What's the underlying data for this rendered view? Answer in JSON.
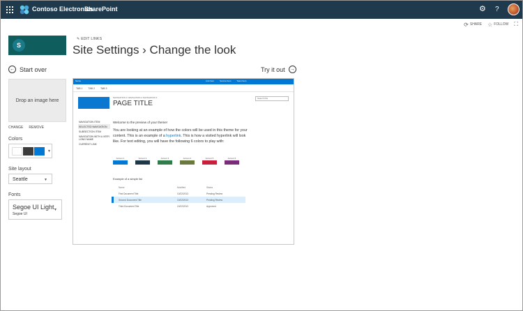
{
  "suite_bar": {
    "brand": "Contoso Electronics",
    "app": "SharePoint",
    "icons": [
      "app-launcher-icon",
      "contoso-logo",
      "gear-icon",
      "help-icon",
      "avatar"
    ]
  },
  "action_bar": {
    "share": "SHARE",
    "follow": "FOLLOW",
    "focus_icon": "focus-icon"
  },
  "header": {
    "logo_letter": "S",
    "edit_links": "EDIT LINKS",
    "title": "Site Settings › Change the look"
  },
  "nav": {
    "start_over": "Start over",
    "try_it_out": "Try it out"
  },
  "left_panel": {
    "drop_image": "Drop an image here",
    "change": "CHANGE",
    "remove": "REMOVE",
    "colors_label": "Colors",
    "color_swatches": [
      "#ffffff",
      "#3b3b3b",
      "#0078d4"
    ],
    "site_layout_label": "Site layout",
    "site_layout_value": "Seattle",
    "fonts_label": "Fonts",
    "font_heading": "Segoe UI Light",
    "font_body": "Segoe UI"
  },
  "preview": {
    "top_bar_name": "Name",
    "top_bar_links": [
      "Link Item",
      "Secure Item",
      "Team Item"
    ],
    "tabs": [
      "TAB 1",
      "TAB 2",
      "TAB 3"
    ],
    "breadcrumb": "NAVIGATION 1  NAVIGATION 2  NAVIGATION 3",
    "page_title": "PAGE TITLE",
    "search_placeholder": "Search this",
    "nav_items": [
      "NAVIGATION ITEM",
      "SELECTED NAVIGATION",
      "SUBSECTION ITEM",
      "NAVIGATION WITH A VERY LONG NAME",
      "CURRENT LINK"
    ],
    "welcome": "Welcome to the preview of your theme!",
    "text_before_link": "You are looking at an example of how the colors will be used in this theme for your content. This is an example of a ",
    "hyperlink": "hyperlink",
    "text_after_link": ". This is how a visited hyperlink will look like. For text editing, you will have the following 6 colors to play with:",
    "accents": [
      {
        "label": "Accent 1",
        "color": "#0078d4"
      },
      {
        "label": "Accent 2",
        "color": "#1e3848"
      },
      {
        "label": "Accent 3",
        "color": "#2e7d4a"
      },
      {
        "label": "Accent 4",
        "color": "#6a7a3e"
      },
      {
        "label": "Accent 5",
        "color": "#c8203c"
      },
      {
        "label": "Accent 6",
        "color": "#7a2b7a"
      }
    ],
    "list_title": "Example of a simple list",
    "list_headers": [
      "Name",
      "Modified",
      "Status"
    ],
    "list_rows": [
      {
        "name": "First Document Title",
        "modified": "10/22/2013",
        "status": "Pending Review"
      },
      {
        "name": "Second Document Title",
        "modified": "10/22/2013",
        "status": "Pending Review"
      },
      {
        "name": "Third Document Title",
        "modified": "10/22/2013",
        "status": "Approved"
      }
    ]
  }
}
